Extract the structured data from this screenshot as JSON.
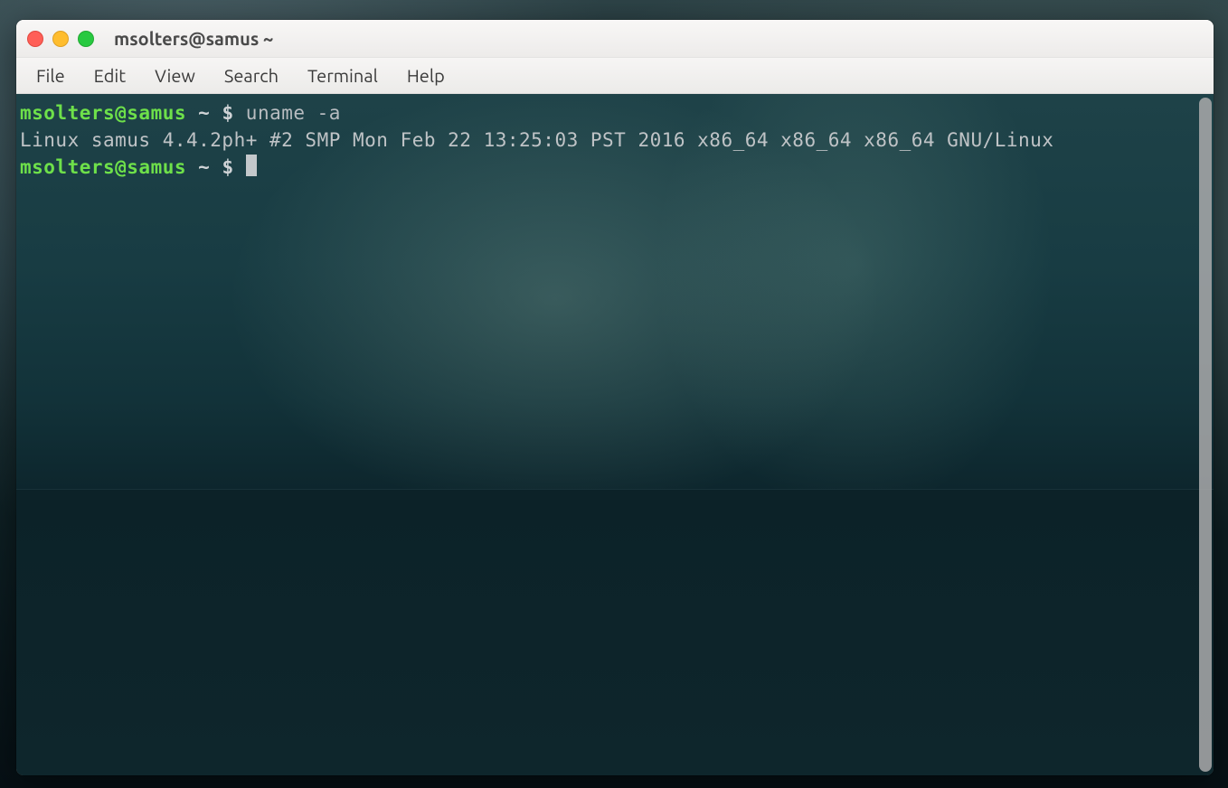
{
  "window": {
    "title": "msolters@samus ~"
  },
  "menubar": {
    "items": [
      "File",
      "Edit",
      "View",
      "Search",
      "Terminal",
      "Help"
    ]
  },
  "terminal": {
    "prompt1": {
      "userhost": "msolters@samus",
      "path": "~",
      "symbol": "$",
      "command": "uname -a"
    },
    "output": "Linux samus 4.4.2ph+ #2 SMP Mon Feb 22 13:25:03 PST 2016 x86_64 x86_64 x86_64 GNU/Linux",
    "prompt2": {
      "userhost": "msolters@samus",
      "path": "~",
      "symbol": "$"
    }
  },
  "colors": {
    "promptUser": "#6ee04a",
    "output": "#bfc3c6",
    "titlebar": "#f3f2f1",
    "closeBtn": "#ff5f57",
    "minBtn": "#ffbd2e",
    "maxBtn": "#28c940"
  }
}
